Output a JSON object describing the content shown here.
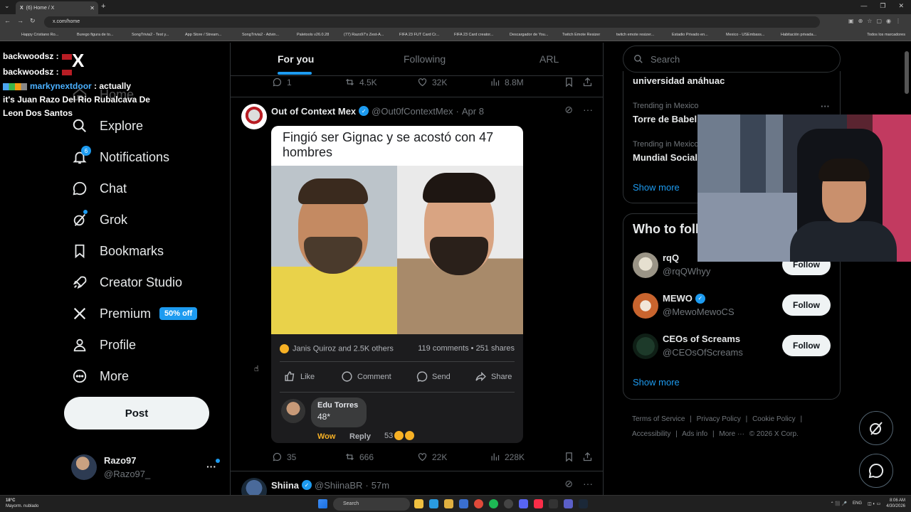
{
  "browser": {
    "tab_title": "(6) Home / X",
    "url": "x.com/home",
    "bookmarks": [
      "Happy Cristiano Ro...",
      "Burego figura de to...",
      "SongTrivia2 - Test y...",
      "App Store / Stream...",
      "SongTrivia2 - Advin...",
      "Paletools v26.0.28",
      "(77) Razo97's Zest-A...",
      "FIFA 23 FUT Card Cr...",
      "FIFA 23 Card creator...",
      "Descargador de You...",
      "Twitch Emote Resizer",
      "twitch emote resizer...",
      "Estadio Privado en...",
      "Mexico - USEmbass...",
      "Habitación privada..."
    ],
    "bookmarks_all": "Todos los marcadores"
  },
  "chat_overlay": {
    "line1_user": "backwoodsz :",
    "line2_user": "backwoodsz :",
    "line3_user": "markynextdoor",
    "line3_text": ": actually",
    "line4": "it's Juan Razo Del Rio Rubalcava De",
    "line5": "Leon Dos Santos"
  },
  "sidebar": {
    "logo": "X",
    "items": [
      {
        "label": "Home",
        "icon": "home-icon"
      },
      {
        "label": "Explore",
        "icon": "search-icon"
      },
      {
        "label": "Notifications",
        "icon": "bell-icon",
        "badge": "6"
      },
      {
        "label": "Chat",
        "icon": "chat-icon"
      },
      {
        "label": "Grok",
        "icon": "grok-icon"
      },
      {
        "label": "Bookmarks",
        "icon": "bookmark-icon"
      },
      {
        "label": "Creator Studio",
        "icon": "rocket-icon"
      },
      {
        "label": "Premium",
        "icon": "x-icon",
        "promo": "50% off"
      },
      {
        "label": "Profile",
        "icon": "person-icon"
      },
      {
        "label": "More",
        "icon": "more-circle-icon"
      }
    ],
    "post_label": "Post",
    "account": {
      "name": "Razo97",
      "handle": "@Razo97_",
      "more": "···"
    }
  },
  "feed": {
    "tabs": [
      "For you",
      "Following",
      "ARL"
    ],
    "active_tab": 0,
    "prev_tweet_actions": {
      "replies": "1",
      "reposts": "4.5K",
      "likes": "32K",
      "views": "8.8M"
    },
    "tweet1": {
      "name": "Out of Context Mex",
      "handle": "@Out0fContextMex",
      "sep": "·",
      "date": "Apr 8",
      "card": {
        "caption": "Fingió ser Gignac y se acostó con 47 hombres",
        "reactions": "Janis Quiroz and 2.5K others",
        "comments": "119 comments",
        "dot": "•",
        "shares": "251 shares",
        "like": "Like",
        "comment": "Comment",
        "send": "Send",
        "share": "Share",
        "commenter": "Edu Torres",
        "comment_text": "48*",
        "wow": "Wow",
        "reply": "Reply",
        "comment_reacts": "53"
      },
      "actions": {
        "replies": "35",
        "reposts": "666",
        "likes": "22K",
        "views": "228K"
      }
    },
    "tweet2": {
      "name": "Shiina",
      "handle": "@ShiinaBR",
      "sep": "·",
      "time": "57m"
    }
  },
  "right": {
    "search_placeholder": "Search",
    "trends": [
      {
        "label": "",
        "name": "universidad anáhuac"
      },
      {
        "label": "Trending in Mexico",
        "name": "Torre de Babel"
      },
      {
        "label": "Trending in Mexico",
        "name": "Mundial Social"
      }
    ],
    "trend_more": "···",
    "show_more": "Show more",
    "who_to_follow": "Who to follow",
    "follow_list": [
      {
        "name": "rqQ",
        "handle": "@rqQWhyy",
        "verified": false,
        "button": "Follow"
      },
      {
        "name": "MEWO",
        "handle": "@MewoMewoCS",
        "verified": true,
        "button": "Follow"
      },
      {
        "name": "CEOs of Screams",
        "handle": "@CEOsOfScreams",
        "verified": false,
        "button": "Follow"
      }
    ],
    "show_more_2": "Show more",
    "footer": [
      "Terms of Service",
      "|",
      "Privacy Policy",
      "|",
      "Cookie Policy",
      "|",
      "Accessibility",
      "|",
      "Ads info",
      "|",
      "More ···",
      "© 2026 X Corp."
    ]
  },
  "taskbar": {
    "temp": "18°C",
    "weather": "Mayorm. nublado",
    "search": "Search",
    "lang": "ENG",
    "time": "8:06 AM",
    "date": "4/30/2026"
  },
  "colors": {
    "accent": "#1d9bf0",
    "background": "#000000",
    "text": "#e7e9ea",
    "muted": "#71767b"
  }
}
